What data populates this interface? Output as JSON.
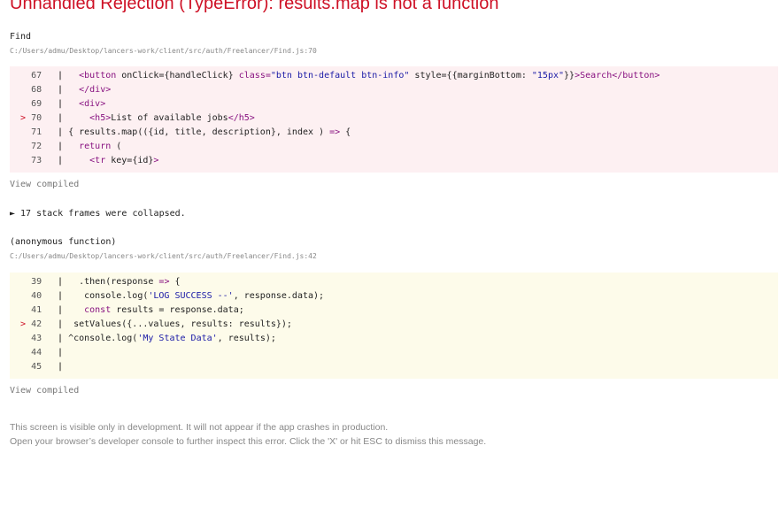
{
  "error_title": "Unhandled Rejection (TypeError): results.map is not a function",
  "frame1": {
    "function": "Find",
    "path": "C:/Users/admu/Desktop/lancers-work/client/src/auth/Freelancer/Find.js:70",
    "lines": [
      {
        "marker": "",
        "num": "67",
        "sep": "|",
        "code": [
          [
            "tok-plain",
            "  "
          ],
          [
            "tok-tag",
            "<button "
          ],
          [
            "tok-attr",
            "onClick={handleClick} "
          ],
          [
            "tok-tag",
            "class="
          ],
          [
            "tok-str",
            "\"btn btn-default btn-info\""
          ],
          [
            "tok-attr",
            " style={{marginBottom: "
          ],
          [
            "tok-str",
            "\"15px\""
          ],
          [
            "tok-attr",
            "}}"
          ],
          [
            "tok-tag",
            ">"
          ],
          [
            "tok-tag",
            "Search"
          ],
          [
            "tok-tag",
            "</button>"
          ]
        ]
      },
      {
        "marker": "",
        "num": "68",
        "sep": "|",
        "code": [
          [
            "tok-plain",
            "  "
          ],
          [
            "tok-tag",
            "</div>"
          ]
        ]
      },
      {
        "marker": "",
        "num": "69",
        "sep": "|",
        "code": [
          [
            "tok-plain",
            "  "
          ],
          [
            "tok-tag",
            "<div>"
          ]
        ]
      },
      {
        "marker": ">",
        "num": "70",
        "sep": "|",
        "code": [
          [
            "tok-plain",
            "    "
          ],
          [
            "tok-tag",
            "<h5>"
          ],
          [
            "tok-plain",
            "List of available jobs"
          ],
          [
            "tok-tag",
            "</h5>"
          ]
        ]
      },
      {
        "marker": "",
        "num": "71",
        "sep": "|",
        "code": [
          [
            "tok-plain",
            "{ results.map(({id, title, description}, index ) "
          ],
          [
            "tok-kw",
            "=>"
          ],
          [
            "tok-plain",
            " {"
          ]
        ]
      },
      {
        "marker": "",
        "num": "72",
        "sep": "|",
        "code": [
          [
            "tok-plain",
            "  "
          ],
          [
            "tok-kw",
            "return"
          ],
          [
            "tok-plain",
            " ("
          ]
        ]
      },
      {
        "marker": "",
        "num": "73",
        "sep": "|",
        "code": [
          [
            "tok-plain",
            "    "
          ],
          [
            "tok-tag",
            "<tr "
          ],
          [
            "tok-plain",
            "key={id}"
          ],
          [
            "tok-tag",
            ">"
          ]
        ]
      }
    ],
    "view_compiled": "View compiled"
  },
  "collapsed_text": "► 17 stack frames were collapsed.",
  "frame2": {
    "function": "(anonymous function)",
    "path": "C:/Users/admu/Desktop/lancers-work/client/src/auth/Freelancer/Find.js:42",
    "lines": [
      {
        "marker": "",
        "num": "39",
        "sep": "|",
        "code": [
          [
            "tok-plain",
            "  .then(response "
          ],
          [
            "tok-kw",
            "=>"
          ],
          [
            "tok-plain",
            " {"
          ]
        ]
      },
      {
        "marker": "",
        "num": "40",
        "sep": "|",
        "code": [
          [
            "tok-plain",
            "   console.log("
          ],
          [
            "tok-str",
            "'LOG SUCCESS --'"
          ],
          [
            "tok-plain",
            ", response.data);"
          ]
        ]
      },
      {
        "marker": "",
        "num": "41",
        "sep": "|",
        "code": [
          [
            "tok-plain",
            "   "
          ],
          [
            "tok-kw",
            "const"
          ],
          [
            "tok-plain",
            " results = response.data;"
          ]
        ]
      },
      {
        "marker": ">",
        "num": "42",
        "sep": "|",
        "code": [
          [
            "tok-plain",
            " setValues({...values, results: results});"
          ]
        ]
      },
      {
        "marker": "",
        "num": "43",
        "sep": "|",
        "code": [
          [
            "tok-plain",
            "^console.log("
          ],
          [
            "tok-str",
            "'My State Data'"
          ],
          [
            "tok-plain",
            ", results);"
          ]
        ]
      },
      {
        "marker": "",
        "num": "44",
        "sep": "|",
        "code": []
      },
      {
        "marker": "",
        "num": "45",
        "sep": "|",
        "code": []
      }
    ],
    "view_compiled": "View compiled"
  },
  "footer": {
    "line1": "This screen is visible only in development. It will not appear if the app crashes in production.",
    "line2": "Open your browser’s developer console to further inspect this error.  Click the 'X' or hit ESC to dismiss this message."
  }
}
